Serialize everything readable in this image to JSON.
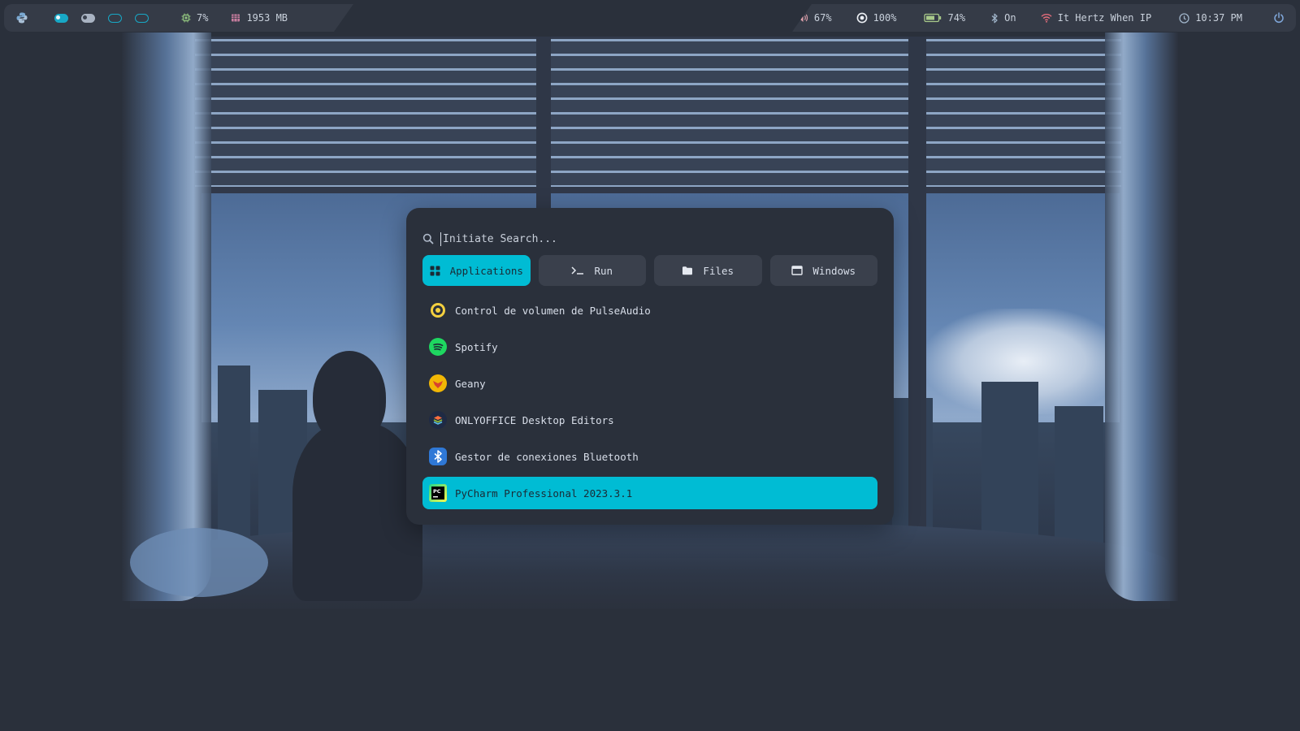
{
  "topbar": {
    "cpu": "7%",
    "memory": "1953 MB",
    "volume": "67%",
    "brightness": "100%",
    "battery": "74%",
    "bluetooth": "On",
    "wifi": "It Hertz When IP",
    "time": "10:37 PM"
  },
  "launcher": {
    "search_placeholder": "Initiate Search...",
    "tabs": [
      {
        "label": "Applications",
        "icon": "grid-icon",
        "active": true
      },
      {
        "label": "Run",
        "icon": "terminal-icon",
        "active": false
      },
      {
        "label": "Files",
        "icon": "folder-icon",
        "active": false
      },
      {
        "label": "Windows",
        "icon": "window-icon",
        "active": false
      }
    ],
    "apps": [
      {
        "label": "Control de volumen de PulseAudio",
        "icon": "pulseaudio-icon",
        "selected": false
      },
      {
        "label": "Spotify",
        "icon": "spotify-icon",
        "selected": false
      },
      {
        "label": "Geany",
        "icon": "geany-icon",
        "selected": false
      },
      {
        "label": "ONLYOFFICE Desktop Editors",
        "icon": "onlyoffice-icon",
        "selected": false
      },
      {
        "label": "Gestor de conexiones Bluetooth",
        "icon": "bluetooth-icon",
        "selected": false
      },
      {
        "label": "PyCharm Professional 2023.3.1",
        "icon": "pycharm-icon",
        "selected": true
      }
    ]
  },
  "colors": {
    "accent": "#00bcd4",
    "panel": "#2a303b",
    "bar": "#353b47",
    "tab_inactive": "#3a404c"
  }
}
